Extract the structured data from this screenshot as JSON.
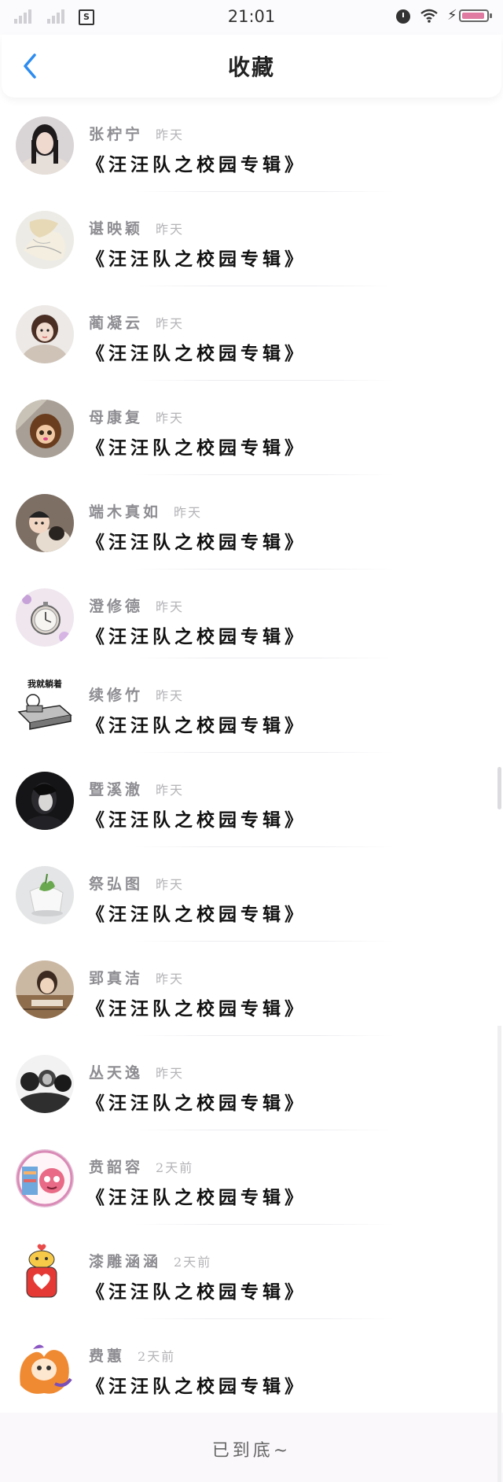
{
  "status_bar": {
    "time": "21:01",
    "sim_label": "S",
    "icons": [
      "signal-icon",
      "signal-icon",
      "sim-icon",
      "alarm-icon",
      "wifi-icon",
      "charging-icon",
      "battery-icon"
    ]
  },
  "nav": {
    "back_icon": "chevron-left-icon",
    "title": "收藏",
    "accent_color": "#2d8cf0"
  },
  "items": [
    {
      "name": "张柠宁",
      "time": "昨天",
      "title": "《汪汪队之校园专辑》",
      "avatar": "woman-portrait"
    },
    {
      "name": "谌映颖",
      "time": "昨天",
      "title": "《汪汪队之校园专辑》",
      "avatar": "anime-sketch"
    },
    {
      "name": "蔺凝云",
      "time": "昨天",
      "title": "《汪汪队之校园专辑》",
      "avatar": "girl-in-fur"
    },
    {
      "name": "母康复",
      "time": "昨天",
      "title": "《汪汪队之校园专辑》",
      "avatar": "monchhichi-doll"
    },
    {
      "name": "端木真如",
      "time": "昨天",
      "title": "《汪汪队之校园专辑》",
      "avatar": "baby-with-dog"
    },
    {
      "name": "澄修德",
      "time": "昨天",
      "title": "《汪汪队之校园专辑》",
      "avatar": "pocket-watch"
    },
    {
      "name": "续修竹",
      "time": "昨天",
      "title": "《汪汪队之校园专辑》",
      "avatar": "meme-lying-down",
      "avatar_caption": "我就躺着"
    },
    {
      "name": "暨溪澈",
      "time": "昨天",
      "title": "《汪汪队之校园专辑》",
      "avatar": "dark-portrait"
    },
    {
      "name": "祭弘图",
      "time": "昨天",
      "title": "《汪汪队之校园专辑》",
      "avatar": "plant-pot"
    },
    {
      "name": "郢真洁",
      "time": "昨天",
      "title": "《汪汪队之校园专辑》",
      "avatar": "girl-vintage"
    },
    {
      "name": "丛天逸",
      "time": "昨天",
      "title": "《汪汪队之校园专辑》",
      "avatar": "group-bw"
    },
    {
      "name": "贲韶容",
      "time": "2天前",
      "title": "《汪汪队之校园专辑》",
      "avatar": "cartoon-cat-pink"
    },
    {
      "name": "漆雕涵涵",
      "time": "2天前",
      "title": "《汪汪队之校园专辑》",
      "avatar": "cartoon-heart"
    },
    {
      "name": "费蕙",
      "time": "2天前",
      "title": "《汪汪队之校园专辑》",
      "avatar": "cartoon-fox"
    }
  ],
  "footer": {
    "end_label": "已到底~"
  }
}
